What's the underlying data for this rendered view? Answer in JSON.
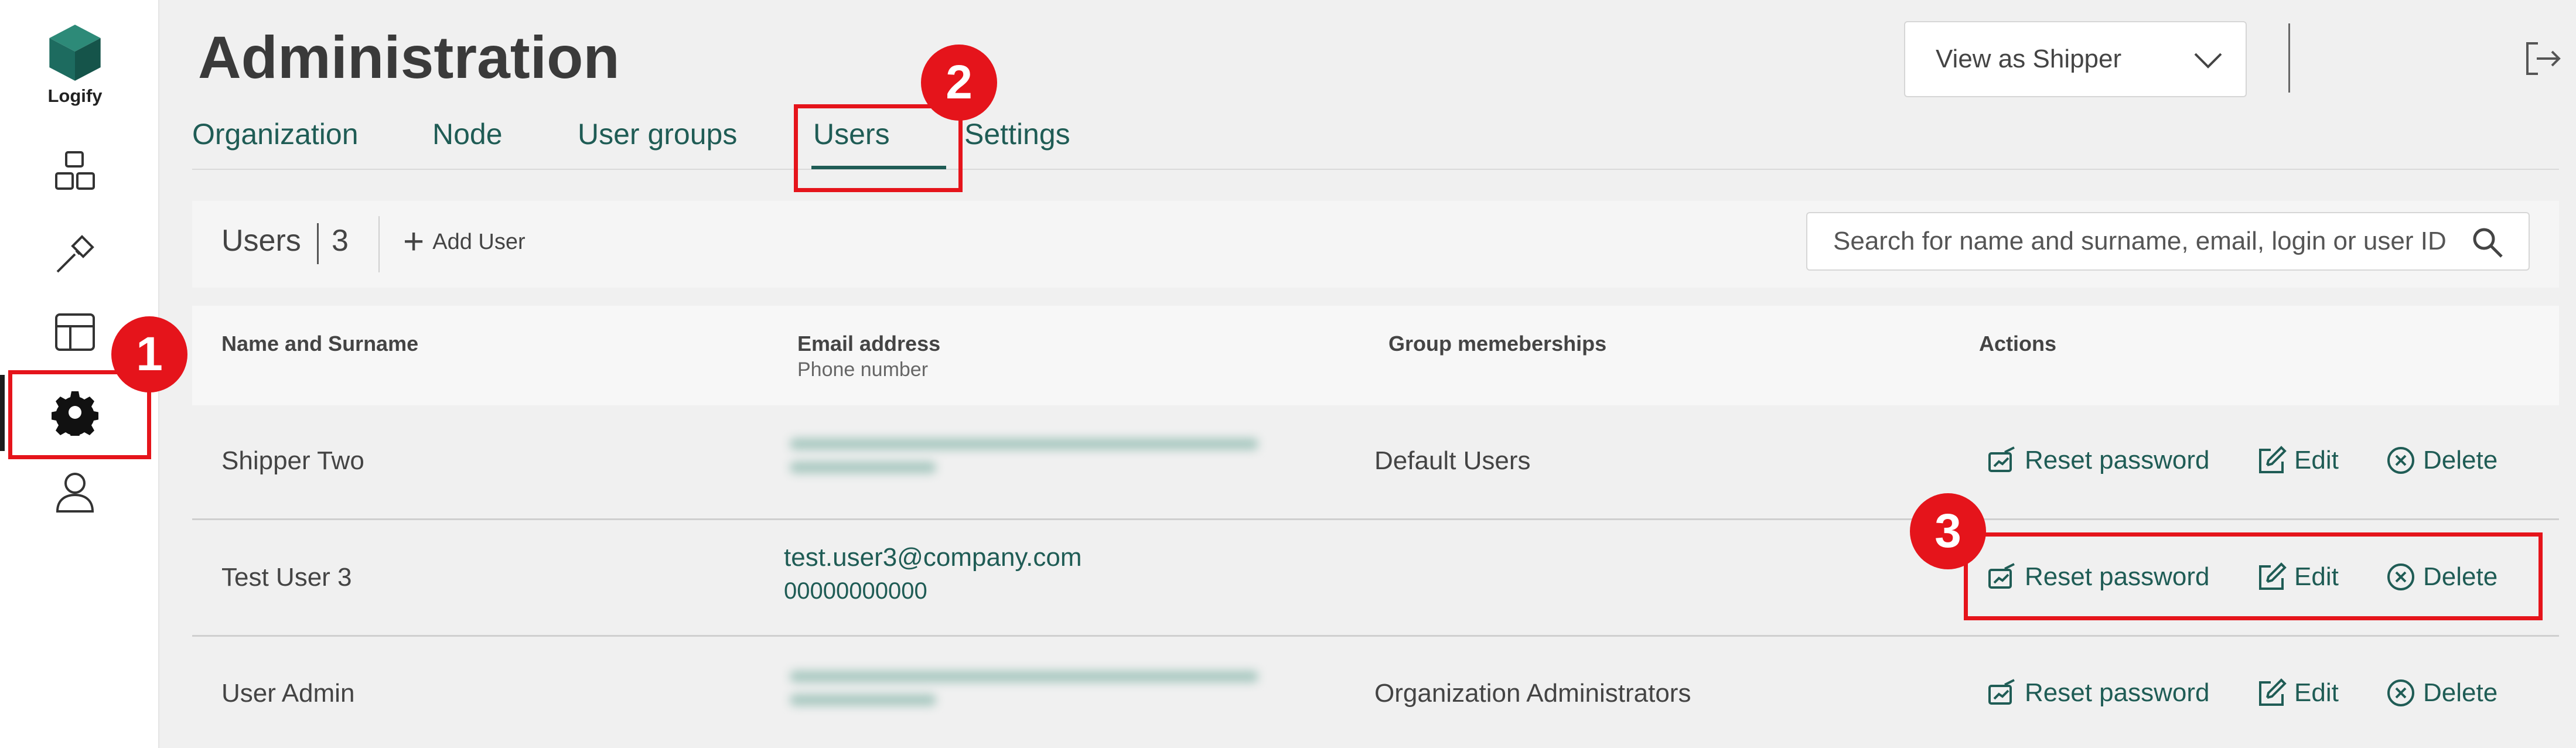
{
  "sidebar": {
    "logo_text": "Logify",
    "icons": [
      "packages-icon",
      "hammer-icon",
      "layout-icon",
      "gear-icon",
      "user-icon"
    ],
    "active": "gear-icon"
  },
  "header": {
    "title": "Administration",
    "view_select": "View as Shipper"
  },
  "tabs": [
    {
      "label": "Organization"
    },
    {
      "label": "Node"
    },
    {
      "label": "User groups"
    },
    {
      "label": "Users",
      "active": true
    },
    {
      "label": "Settings"
    }
  ],
  "toolbar": {
    "title": "Users",
    "count": "3",
    "add_label": "Add User",
    "search_placeholder": "Search for name and surname, email, login or user ID"
  },
  "table": {
    "headers": {
      "name": "Name and Surname",
      "email": "Email address",
      "email_sub": "Phone number",
      "groups": "Group memeberships",
      "actions": "Actions"
    },
    "rows": [
      {
        "name": "Shipper Two",
        "email": "",
        "phone": "",
        "email_blurred": true,
        "groups": "Default Users"
      },
      {
        "name": "Test User 3",
        "email": "test.user3@company.com",
        "phone": "00000000000",
        "email_blurred": false,
        "groups": ""
      },
      {
        "name": "User Admin",
        "email": "",
        "phone": "",
        "email_blurred": true,
        "groups": "Organization Administrators"
      }
    ],
    "actions": {
      "reset": "Reset password",
      "edit": "Edit",
      "delete": "Delete"
    }
  },
  "annotations": {
    "badge1": "1",
    "badge2": "2",
    "badge3": "3",
    "color": "#e5141b"
  },
  "colors": {
    "accent": "#1f5c55",
    "logo": "#1d6b5f"
  }
}
